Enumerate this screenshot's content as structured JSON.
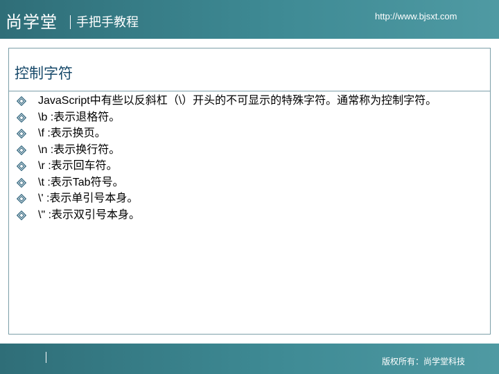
{
  "header": {
    "brand": "尚学堂",
    "subtitle": "手把手教程",
    "url": "http://www.bjsxt.com"
  },
  "slide": {
    "title": "控制字符",
    "bullets": [
      "JavaScript中有些以反斜杠（\\）开头的不可显示的特殊字符。通常称为控制字符。",
      "\\b :表示退格符。",
      "\\f :表示换页。",
      "\\n :表示换行符。",
      "\\r :表示回车符。",
      "\\t :表示Tab符号。",
      "\\' :表示单引号本身。",
      "\\\" :表示双引号本身。"
    ]
  },
  "footer": {
    "text": "版权所有：尚学堂科技"
  },
  "colors": {
    "bar": "#3e8a94",
    "title": "#17496a",
    "bullet_icon": "#3e6f86",
    "frame_border": "#7b9ea8"
  },
  "icons": {
    "bullet": "diamond-bullet-icon"
  }
}
